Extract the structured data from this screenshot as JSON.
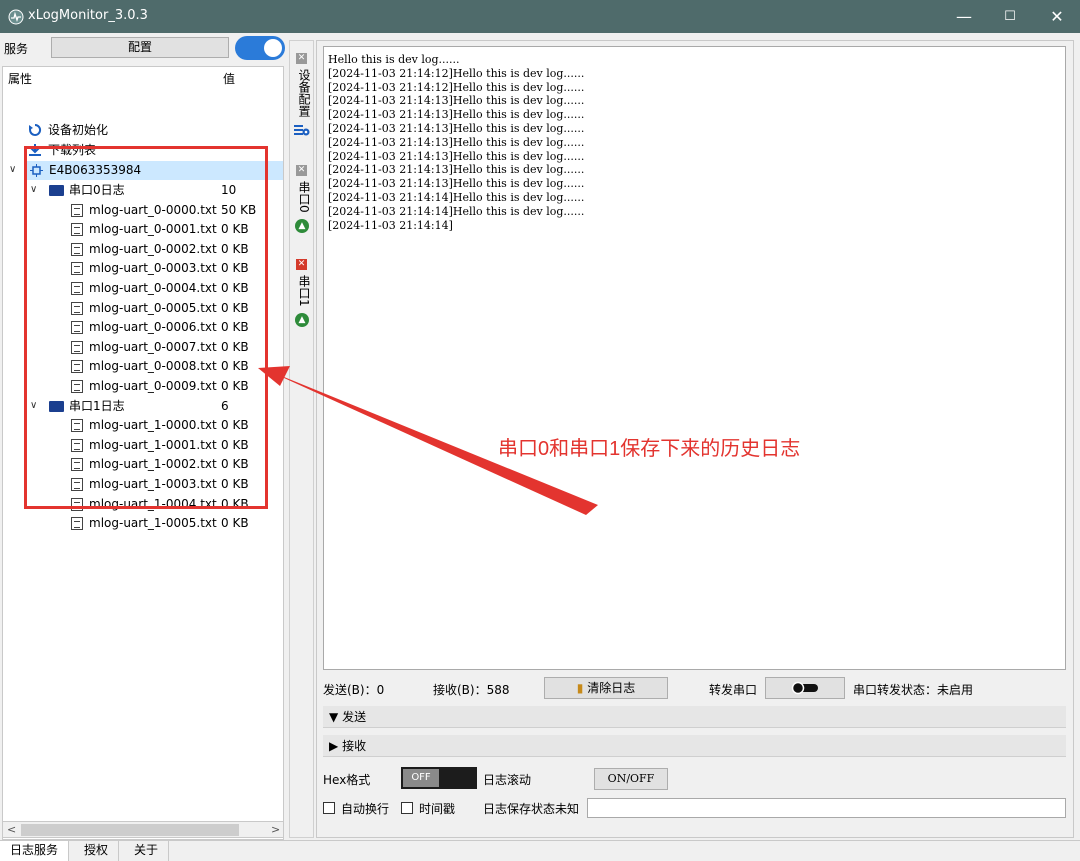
{
  "window": {
    "title": "xLogMonitor_3.0.3",
    "controls": {
      "minimize": "—",
      "maximize": "☐",
      "close": "✕"
    }
  },
  "left_panel": {
    "service_label": "服务",
    "config_button": "配置",
    "toggle_on": true,
    "tree_header": {
      "attr": "属性",
      "value": "值"
    },
    "items": [
      {
        "label": "设备初始化",
        "icon": "refresh-icon"
      },
      {
        "label": "下载列表",
        "icon": "download-icon"
      }
    ],
    "device": "E4B063353984",
    "groups": [
      {
        "label": "串口0日志",
        "count": "10",
        "files": [
          {
            "name": "mlog-uart_0-0000.txt",
            "size": "50 KB"
          },
          {
            "name": "mlog-uart_0-0001.txt",
            "size": "0 KB"
          },
          {
            "name": "mlog-uart_0-0002.txt",
            "size": "0 KB"
          },
          {
            "name": "mlog-uart_0-0003.txt",
            "size": "0 KB"
          },
          {
            "name": "mlog-uart_0-0004.txt",
            "size": "0 KB"
          },
          {
            "name": "mlog-uart_0-0005.txt",
            "size": "0 KB"
          },
          {
            "name": "mlog-uart_0-0006.txt",
            "size": "0 KB"
          },
          {
            "name": "mlog-uart_0-0007.txt",
            "size": "0 KB"
          },
          {
            "name": "mlog-uart_0-0008.txt",
            "size": "0 KB"
          },
          {
            "name": "mlog-uart_0-0009.txt",
            "size": "0 KB"
          }
        ]
      },
      {
        "label": "串口1日志",
        "count": "6",
        "files": [
          {
            "name": "mlog-uart_1-0000.txt",
            "size": "0 KB"
          },
          {
            "name": "mlog-uart_1-0001.txt",
            "size": "0 KB"
          },
          {
            "name": "mlog-uart_1-0002.txt",
            "size": "0 KB"
          },
          {
            "name": "mlog-uart_1-0003.txt",
            "size": "0 KB"
          },
          {
            "name": "mlog-uart_1-0004.txt",
            "size": "0 KB"
          },
          {
            "name": "mlog-uart_1-0005.txt",
            "size": "0 KB"
          }
        ]
      }
    ]
  },
  "bottom_tabs": [
    "日志服务",
    "授权",
    "关于"
  ],
  "vertical_tabs": [
    {
      "label": "设备配置"
    },
    {
      "label": "串口0"
    },
    {
      "label": "串口1"
    }
  ],
  "log_lines": [
    "Hello this is dev log......",
    "[2024-11-03 21:14:12]Hello this is dev log......",
    "[2024-11-03 21:14:12]Hello this is dev log......",
    "[2024-11-03 21:14:13]Hello this is dev log......",
    "[2024-11-03 21:14:13]Hello this is dev log......",
    "[2024-11-03 21:14:13]Hello this is dev log......",
    "[2024-11-03 21:14:13]Hello this is dev log......",
    "[2024-11-03 21:14:13]Hello this is dev log......",
    "[2024-11-03 21:14:13]Hello this is dev log......",
    "[2024-11-03 21:14:13]Hello this is dev log......",
    "[2024-11-03 21:14:14]Hello this is dev log......",
    "[2024-11-03 21:14:14]Hello this is dev log......",
    "[2024-11-03 21:14:14]"
  ],
  "status": {
    "sent": "发送(B)：0",
    "received": "接收(B)：588",
    "clear_button": "清除日志",
    "forward_label": "转发串口",
    "forward_status": "串口转发状态：未启用"
  },
  "sections": {
    "send": "发送",
    "receive": "接收"
  },
  "options": {
    "hex_label": "Hex格式",
    "hex_toggle": "OFF",
    "scroll_label": "日志滚动",
    "scroll_button": "ON/OFF",
    "auto_wrap": "自动换行",
    "timestamp": "时间戳",
    "save_status": "日志保存状态未知"
  },
  "annotation": "串口0和串口1保存下来的历史日志",
  "colors": {
    "titlebar": "#4f6b6b",
    "accent": "#2b7bd9",
    "annotation": "#e3342f"
  }
}
